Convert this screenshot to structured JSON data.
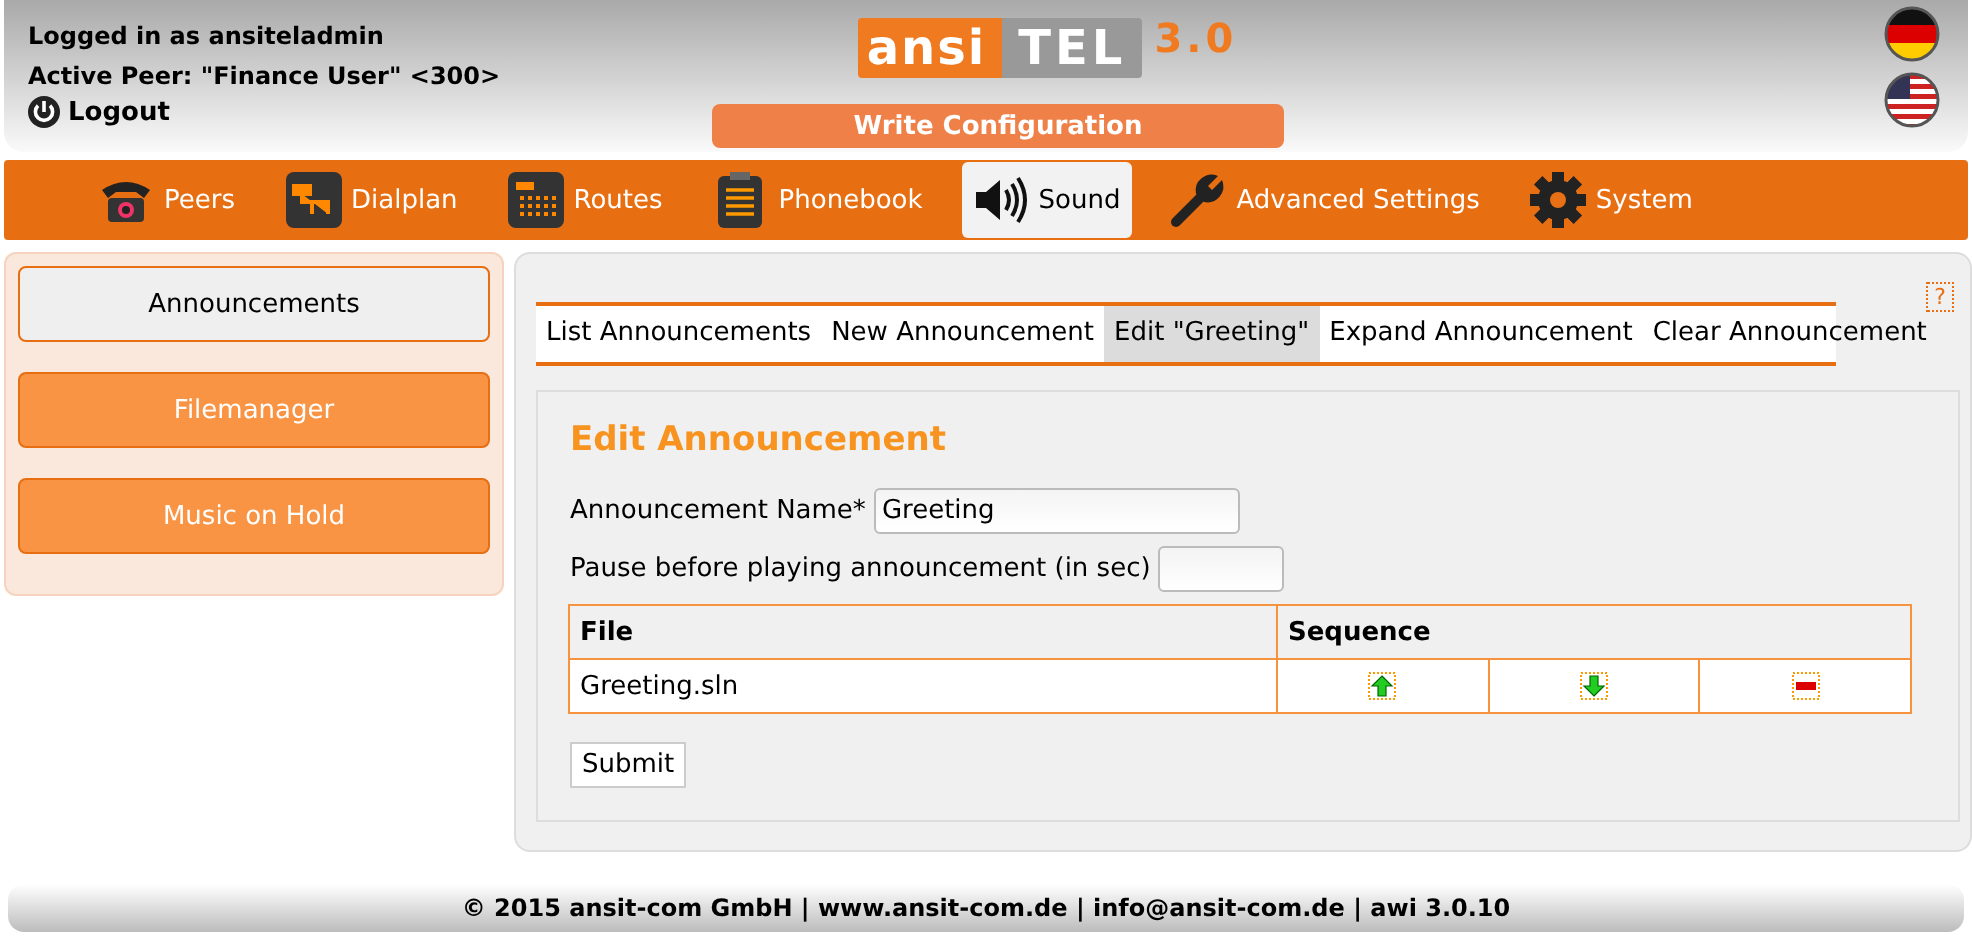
{
  "header": {
    "login": "Logged in as ansiteladmin",
    "peer": "Active Peer: \"Finance User\" <300>",
    "logout": "Logout",
    "logo": {
      "part_1": "ansi",
      "part_2": "TEL",
      "version": "3.0"
    },
    "write_button": "Write Configuration"
  },
  "nav": [
    {
      "label": "Peers",
      "selected": false
    },
    {
      "label": "Dialplan",
      "selected": false
    },
    {
      "label": "Routes",
      "selected": false
    },
    {
      "label": "Phonebook",
      "selected": false
    },
    {
      "label": "Sound",
      "selected": true
    },
    {
      "label": "Advanced Settings",
      "selected": false
    },
    {
      "label": "System",
      "selected": false
    }
  ],
  "sidebar": {
    "items": [
      {
        "label": "Announcements",
        "selected": true
      },
      {
        "label": "Filemanager",
        "selected": false
      },
      {
        "label": "Music on Hold",
        "selected": false
      }
    ]
  },
  "help": "?",
  "tabs": [
    {
      "label": "List Announcements",
      "selected": false
    },
    {
      "label": "New Announcement",
      "selected": false
    },
    {
      "label": "Edit \"Greeting\"",
      "selected": true
    },
    {
      "label": "Expand Announcement",
      "selected": false
    },
    {
      "label": "Clear Announcement",
      "selected": false
    }
  ],
  "form": {
    "title": "Edit Announcement",
    "name_label": "Announcement Name*",
    "name_value": "Greeting",
    "pause_label": "Pause before playing announcement (in sec)",
    "table": {
      "columns": [
        "File",
        "Sequence"
      ],
      "rows": [
        {
          "file": "Greeting.sln"
        }
      ]
    },
    "submit": "Submit"
  },
  "footer": "© 2015 ansit-com GmbH | www.ansit-com.de | info@ansit-com.de | awi 3.0.10"
}
